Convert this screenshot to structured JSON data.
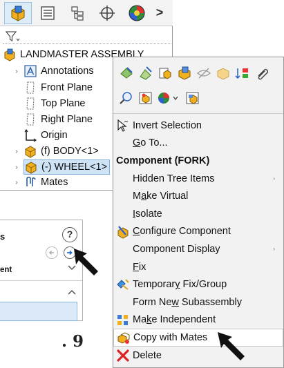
{
  "tree": {
    "root_label": "LANDMASTER ASSEMBLY",
    "items": [
      {
        "label": "Annotations",
        "expander": "›",
        "icon": "annotations-icon"
      },
      {
        "label": "Front Plane",
        "expander": "",
        "icon": "plane-icon"
      },
      {
        "label": "Top Plane",
        "expander": "",
        "icon": "plane-icon"
      },
      {
        "label": "Right Plane",
        "expander": "",
        "icon": "plane-icon"
      },
      {
        "label": "Origin",
        "expander": "",
        "icon": "origin-icon"
      },
      {
        "label": "(f) BODY<1>",
        "expander": "›",
        "icon": "part-icon"
      },
      {
        "label": "(-) WHEEL<1>",
        "expander": "›",
        "icon": "part-icon"
      },
      {
        "label": "Mates",
        "expander": "›",
        "icon": "mates-icon"
      }
    ]
  },
  "prop_panel": {
    "title_fragment": "s",
    "help": "?",
    "group_label_fragment": "ent"
  },
  "figure_label": "9",
  "context_menu": {
    "items": [
      {
        "type": "item",
        "pre": "Invert Selection",
        "u": "",
        "post": "",
        "icon": "invert-selection-icon",
        "submenu": false
      },
      {
        "type": "item",
        "pre": "",
        "u": "G",
        "post": "o To...",
        "icon": "",
        "submenu": false
      },
      {
        "type": "section",
        "pre": "Component (FORK)",
        "u": "",
        "post": "",
        "icon": "",
        "submenu": false
      },
      {
        "type": "item",
        "pre": "Hidden Tree Items",
        "u": "",
        "post": "",
        "icon": "",
        "submenu": true
      },
      {
        "type": "item",
        "pre": "M",
        "u": "a",
        "post": "ke Virtual",
        "icon": "",
        "submenu": false
      },
      {
        "type": "item",
        "pre": "",
        "u": "I",
        "post": "solate",
        "icon": "",
        "submenu": false
      },
      {
        "type": "item",
        "pre": "",
        "u": "C",
        "post": "onfigure Component",
        "icon": "configure-component-icon",
        "submenu": false
      },
      {
        "type": "item",
        "pre": "Component Display",
        "u": "",
        "post": "",
        "icon": "",
        "submenu": true
      },
      {
        "type": "item",
        "pre": "",
        "u": "F",
        "post": "ix",
        "icon": "",
        "submenu": false
      },
      {
        "type": "item",
        "pre": "Temporar",
        "u": "y",
        "post": " Fix/Group",
        "icon": "temporary-fix-icon",
        "submenu": false
      },
      {
        "type": "item",
        "pre": "Form Ne",
        "u": "w",
        "post": " Subassembly",
        "icon": "",
        "submenu": false
      },
      {
        "type": "item",
        "pre": "Ma",
        "u": "k",
        "post": "e Independent",
        "icon": "make-independent-icon",
        "submenu": false
      },
      {
        "type": "item",
        "pre": "Copy with Mates",
        "u": "",
        "post": "",
        "icon": "copy-with-mates-icon",
        "submenu": false,
        "highlighted": true
      },
      {
        "type": "item",
        "pre": "Delete",
        "u": "",
        "post": "",
        "icon": "delete-icon",
        "submenu": false
      }
    ]
  },
  "colors": {
    "selection_fill": "#cfe3f7",
    "selection_border": "#7fb0de",
    "menu_bg": "#f2f2f2",
    "delete_red": "#e02020",
    "part_yellow": "#f2b021"
  }
}
